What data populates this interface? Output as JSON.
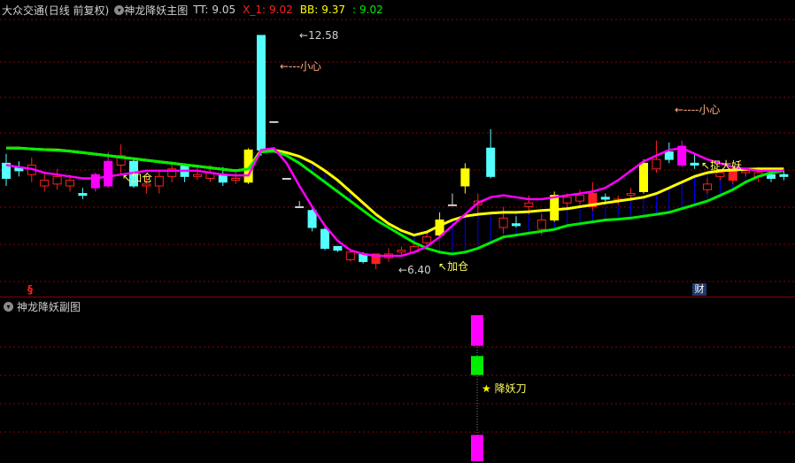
{
  "header": {
    "stock_name": "大众交通",
    "period_info": "(日线 前复权)",
    "indicator_name": "神龙降妖主图",
    "tt_label": "TT:",
    "tt_value": "9.05",
    "x1_label": "X_1:",
    "x1_value": "9.02",
    "bb_label": "BB:",
    "bb_value": "9.37",
    "extra_label": ":",
    "extra_value": "9.02"
  },
  "annotations": {
    "high_price": "12.58",
    "low_price": "6.40",
    "caution_1": "小心",
    "caution_2": "小心",
    "add_1": "加仓",
    "add_2": "加仓",
    "catch": "捉大妖"
  },
  "sub_panel": {
    "title": "神龙降妖副图",
    "signal_label": "降妖刀"
  },
  "markers": {
    "s_marker": "§",
    "cai_marker": "财"
  },
  "colors": {
    "up": "#ff2020",
    "down": "#55ffff",
    "yellow": "#ffff00",
    "green": "#00ee00",
    "magenta": "#ff00ff",
    "grid": "#8b0000",
    "fill": "#0000ff"
  },
  "chart_data": {
    "type": "candlestick",
    "price_scale": {
      "min": 6.4,
      "max": 12.58
    },
    "candles": [
      {
        "o": 9.2,
        "c": 8.8,
        "h": 9.45,
        "l": 8.6,
        "k": "down"
      },
      {
        "o": 9.0,
        "c": 9.1,
        "h": 9.25,
        "l": 8.85,
        "k": "down"
      },
      {
        "o": 8.9,
        "c": 9.15,
        "h": 9.35,
        "l": 8.7,
        "k": "up"
      },
      {
        "o": 8.75,
        "c": 8.6,
        "h": 8.95,
        "l": 8.45,
        "k": "up"
      },
      {
        "o": 8.65,
        "c": 8.85,
        "h": 9.05,
        "l": 8.5,
        "k": "up"
      },
      {
        "o": 8.6,
        "c": 8.75,
        "h": 8.9,
        "l": 8.45,
        "k": "up"
      },
      {
        "o": 8.4,
        "c": 8.35,
        "h": 8.55,
        "l": 8.25,
        "k": "down"
      },
      {
        "o": 8.55,
        "c": 8.9,
        "h": 8.95,
        "l": 8.45,
        "k": "magenta"
      },
      {
        "o": 8.6,
        "c": 9.25,
        "h": 9.5,
        "l": 8.55,
        "k": "magenta"
      },
      {
        "o": 9.15,
        "c": 9.4,
        "h": 9.7,
        "l": 8.9,
        "k": "up"
      },
      {
        "o": 9.25,
        "c": 8.6,
        "h": 9.3,
        "l": 8.55,
        "k": "down"
      },
      {
        "o": 8.6,
        "c": 8.65,
        "h": 8.9,
        "l": 8.4,
        "k": "up"
      },
      {
        "o": 8.85,
        "c": 8.6,
        "h": 9.0,
        "l": 8.4,
        "k": "up"
      },
      {
        "o": 8.85,
        "c": 9.05,
        "h": 9.25,
        "l": 8.7,
        "k": "up"
      },
      {
        "o": 9.15,
        "c": 8.85,
        "h": 9.2,
        "l": 8.7,
        "k": "down"
      },
      {
        "o": 8.9,
        "c": 8.85,
        "h": 9.1,
        "l": 8.75,
        "k": "up"
      },
      {
        "o": 8.8,
        "c": 8.95,
        "h": 9.15,
        "l": 8.7,
        "k": "up"
      },
      {
        "o": 8.9,
        "c": 8.7,
        "h": 9.1,
        "l": 8.6,
        "k": "down"
      },
      {
        "o": 8.8,
        "c": 8.75,
        "h": 8.95,
        "l": 8.65,
        "k": "up"
      },
      {
        "o": 8.7,
        "c": 9.55,
        "h": 9.6,
        "l": 8.65,
        "k": "yellow"
      },
      {
        "o": 9.55,
        "c": 12.58,
        "h": 12.58,
        "l": 9.4,
        "k": "down"
      },
      {
        "o": 10.3,
        "c": 10.3,
        "h": 10.3,
        "l": 10.3,
        "k": "cross"
      },
      {
        "o": 8.8,
        "c": 8.8,
        "h": 8.8,
        "l": 8.8,
        "k": "cross"
      },
      {
        "o": 8.05,
        "c": 8.05,
        "h": 8.2,
        "l": 8.05,
        "k": "cross"
      },
      {
        "o": 7.95,
        "c": 7.5,
        "h": 8.0,
        "l": 7.4,
        "k": "down"
      },
      {
        "o": 7.45,
        "c": 6.95,
        "h": 7.5,
        "l": 6.9,
        "k": "down"
      },
      {
        "o": 7.0,
        "c": 6.9,
        "h": 7.0,
        "l": 6.85,
        "k": "down"
      },
      {
        "o": 6.65,
        "c": 6.85,
        "h": 6.9,
        "l": 6.6,
        "k": "up"
      },
      {
        "o": 6.8,
        "c": 6.6,
        "h": 6.85,
        "l": 6.55,
        "k": "down"
      },
      {
        "o": 6.55,
        "c": 6.8,
        "h": 6.8,
        "l": 6.4,
        "k": "red"
      },
      {
        "o": 6.8,
        "c": 6.7,
        "h": 6.95,
        "l": 6.6,
        "k": "up"
      },
      {
        "o": 6.85,
        "c": 6.9,
        "h": 7.0,
        "l": 6.75,
        "k": "up"
      },
      {
        "o": 6.85,
        "c": 7.0,
        "h": 7.1,
        "l": 6.8,
        "k": "up"
      },
      {
        "o": 7.25,
        "c": 7.1,
        "h": 7.35,
        "l": 7.05,
        "k": "up"
      },
      {
        "o": 7.3,
        "c": 7.7,
        "h": 7.9,
        "l": 7.25,
        "k": "yellow"
      },
      {
        "o": 8.1,
        "c": 8.1,
        "h": 8.4,
        "l": 8.1,
        "k": "cross"
      },
      {
        "o": 8.6,
        "c": 9.05,
        "h": 9.2,
        "l": 8.4,
        "k": "yellow"
      },
      {
        "o": 8.1,
        "c": 8.2,
        "h": 8.4,
        "l": 7.8,
        "k": "up"
      },
      {
        "o": 8.85,
        "c": 9.6,
        "h": 10.1,
        "l": 8.8,
        "k": "down"
      },
      {
        "o": 7.5,
        "c": 7.75,
        "h": 8.05,
        "l": 7.35,
        "k": "up"
      },
      {
        "o": 7.6,
        "c": 7.55,
        "h": 7.8,
        "l": 7.5,
        "k": "down"
      },
      {
        "o": 8.05,
        "c": 8.15,
        "h": 8.35,
        "l": 7.85,
        "k": "up"
      },
      {
        "o": 7.45,
        "c": 7.7,
        "h": 7.85,
        "l": 7.3,
        "k": "up"
      },
      {
        "o": 7.7,
        "c": 8.35,
        "h": 8.45,
        "l": 7.65,
        "k": "yellow"
      },
      {
        "o": 8.15,
        "c": 8.3,
        "h": 8.4,
        "l": 8.0,
        "k": "up"
      },
      {
        "o": 8.35,
        "c": 8.2,
        "h": 8.5,
        "l": 8.1,
        "k": "up"
      },
      {
        "o": 8.05,
        "c": 8.4,
        "h": 8.7,
        "l": 7.95,
        "k": "red"
      },
      {
        "o": 8.3,
        "c": 8.25,
        "h": 8.4,
        "l": 8.15,
        "k": "down"
      },
      {
        "o": 8.25,
        "c": 8.2,
        "h": 8.35,
        "l": 8.1,
        "k": "up"
      },
      {
        "o": 8.35,
        "c": 8.4,
        "h": 8.55,
        "l": 8.2,
        "k": "up"
      },
      {
        "o": 8.45,
        "c": 9.2,
        "h": 9.3,
        "l": 8.4,
        "k": "yellow"
      },
      {
        "o": 9.05,
        "c": 9.3,
        "h": 9.8,
        "l": 8.95,
        "k": "up"
      },
      {
        "o": 9.5,
        "c": 9.3,
        "h": 9.75,
        "l": 9.2,
        "k": "down"
      },
      {
        "o": 9.15,
        "c": 9.65,
        "h": 9.8,
        "l": 9.1,
        "k": "magenta"
      },
      {
        "o": 9.2,
        "c": 9.15,
        "h": 9.45,
        "l": 9.05,
        "k": "down"
      },
      {
        "o": 8.5,
        "c": 8.65,
        "h": 8.8,
        "l": 8.4,
        "k": "up"
      },
      {
        "o": 8.85,
        "c": 8.95,
        "h": 9.05,
        "l": 8.75,
        "k": "up"
      },
      {
        "o": 9.05,
        "c": 8.75,
        "h": 9.2,
        "l": 8.65,
        "k": "red"
      },
      {
        "o": 9.0,
        "c": 8.95,
        "h": 9.1,
        "l": 8.85,
        "k": "up"
      },
      {
        "o": 8.85,
        "c": 8.95,
        "h": 9.1,
        "l": 8.7,
        "k": "up"
      },
      {
        "o": 8.8,
        "c": 8.9,
        "h": 9.0,
        "l": 8.7,
        "k": "down"
      },
      {
        "o": 8.85,
        "c": 8.9,
        "h": 9.0,
        "l": 8.75,
        "k": "down"
      }
    ],
    "x1_line": [
      9.15,
      9.1,
      9.05,
      8.95,
      8.9,
      8.85,
      8.8,
      8.8,
      8.85,
      8.9,
      8.95,
      9.0,
      9.0,
      9.0,
      9.0,
      9.0,
      8.95,
      8.9,
      8.88,
      8.88,
      9.55,
      9.6,
      9.2,
      8.6,
      8.05,
      7.55,
      7.15,
      6.9,
      6.8,
      6.75,
      6.75,
      6.75,
      6.85,
      7.0,
      7.25,
      7.55,
      7.85,
      8.15,
      8.3,
      8.35,
      8.3,
      8.25,
      8.25,
      8.3,
      8.35,
      8.4,
      8.45,
      8.55,
      8.75,
      9.0,
      9.25,
      9.4,
      9.55,
      9.6,
      9.45,
      9.3,
      9.2,
      9.1,
      9.05,
      9.0,
      9.0,
      9.0
    ],
    "bb_line": [
      9.6,
      9.6,
      9.58,
      9.56,
      9.54,
      9.52,
      9.48,
      9.44,
      9.4,
      9.36,
      9.32,
      9.28,
      9.24,
      9.2,
      9.16,
      9.12,
      9.08,
      9.04,
      9.0,
      9.05,
      9.5,
      9.52,
      9.4,
      9.2,
      8.95,
      8.7,
      8.45,
      8.2,
      7.95,
      7.7,
      7.5,
      7.3,
      7.1,
      6.95,
      6.85,
      6.8,
      6.85,
      6.95,
      7.1,
      7.25,
      7.3,
      7.35,
      7.4,
      7.45,
      7.55,
      7.6,
      7.65,
      7.7,
      7.72,
      7.75,
      7.8,
      7.85,
      7.9,
      8.0,
      8.1,
      8.2,
      8.35,
      8.5,
      8.7,
      8.85,
      8.95,
      9.0
    ],
    "tt_line": [
      9.6,
      9.6,
      9.58,
      9.56,
      9.55,
      9.52,
      9.48,
      9.44,
      9.4,
      9.36,
      9.32,
      9.28,
      9.24,
      9.2,
      9.16,
      9.12,
      9.08,
      9.04,
      9.0,
      9.05,
      9.55,
      9.55,
      9.48,
      9.38,
      9.22,
      9.0,
      8.75,
      8.45,
      8.15,
      7.85,
      7.6,
      7.42,
      7.3,
      7.38,
      7.55,
      7.7,
      7.8,
      7.85,
      7.88,
      7.9,
      7.9,
      7.92,
      7.95,
      7.97,
      8.0,
      8.05,
      8.1,
      8.15,
      8.2,
      8.25,
      8.3,
      8.4,
      8.55,
      8.7,
      8.85,
      8.95,
      9.0,
      9.02,
      9.04,
      9.05,
      9.05,
      9.05
    ],
    "sub_signal": {
      "bars": [
        {
          "color": "magenta",
          "from": 0.0,
          "to": 0.21
        },
        {
          "color": "green",
          "from": 0.28,
          "to": 0.41
        },
        {
          "color": "magenta",
          "from": 0.82,
          "to": 1.0
        }
      ]
    }
  }
}
